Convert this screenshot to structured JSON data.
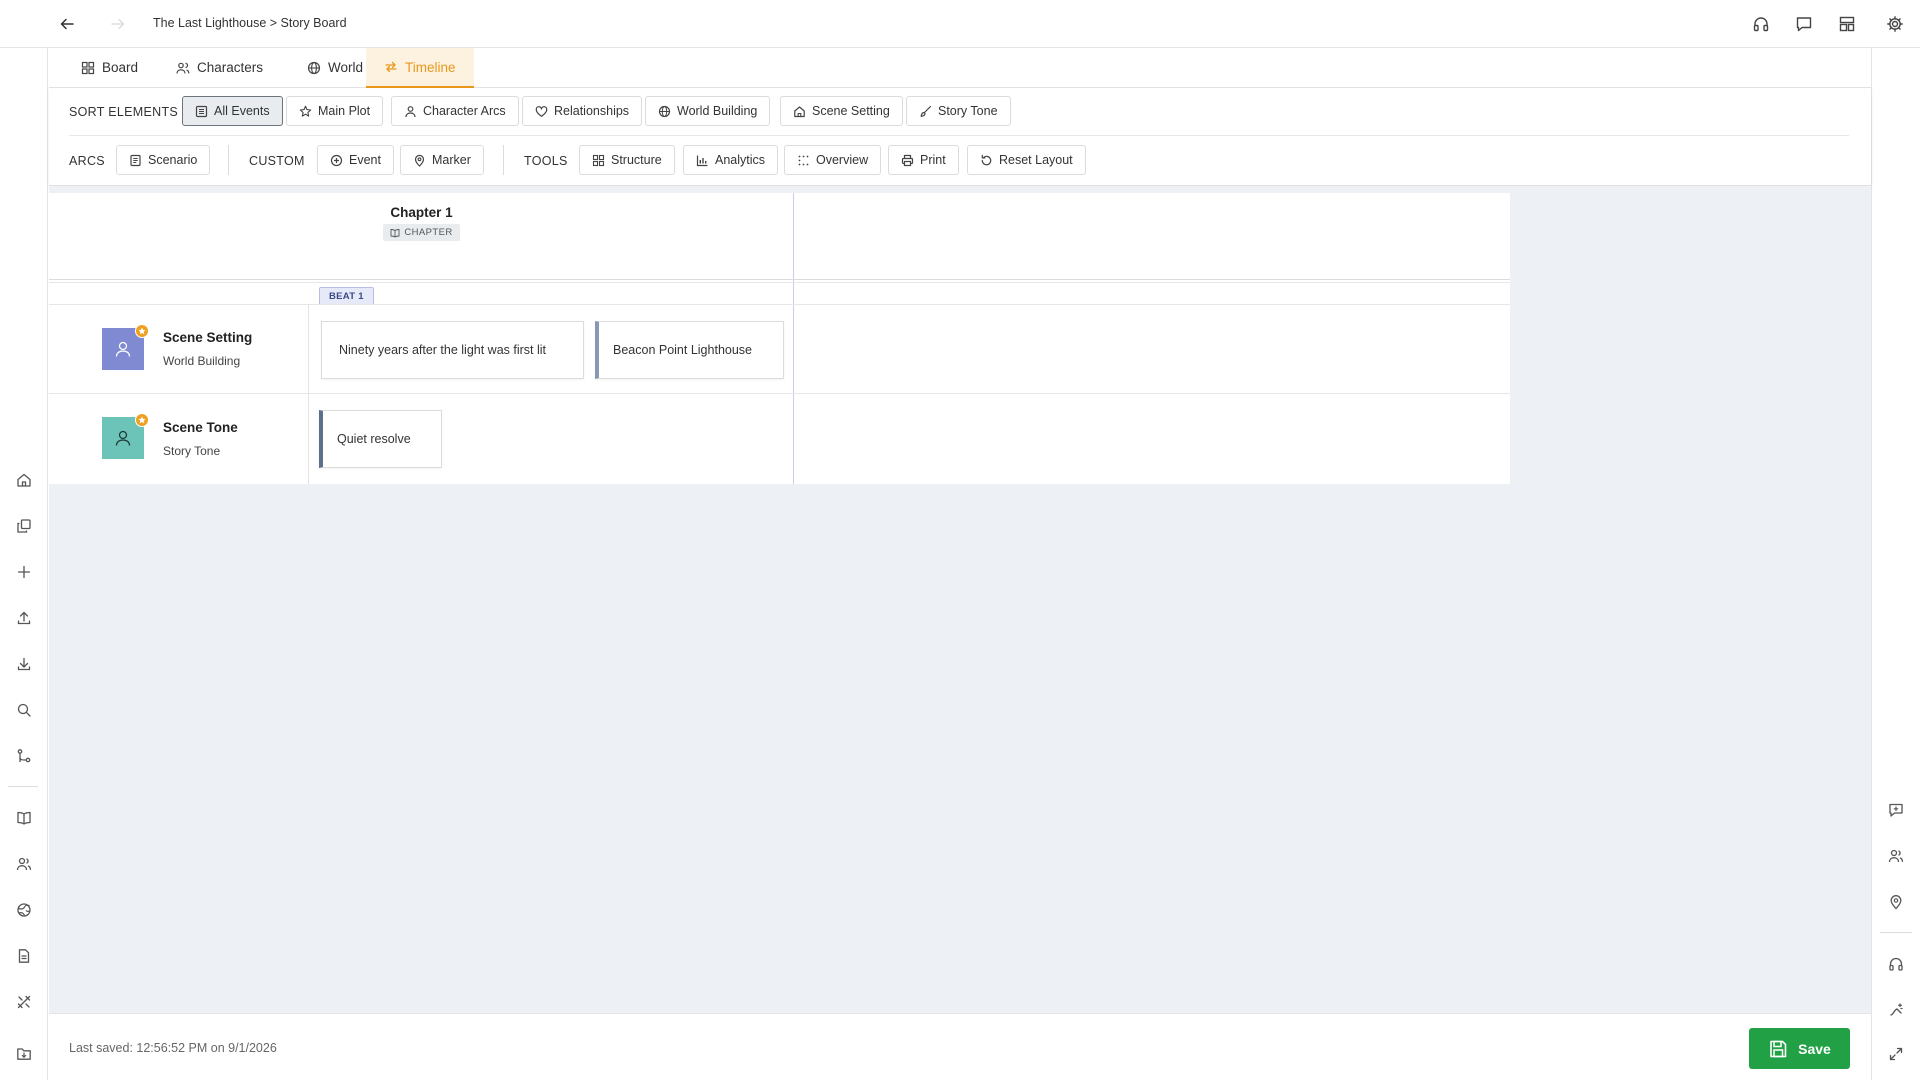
{
  "topbar": {
    "breadcrumb": "The Last Lighthouse > Story Board",
    "icons": [
      "back-icon",
      "forward-icon",
      "headphones-icon",
      "chat-icon",
      "layout-icon",
      "settings-icon"
    ]
  },
  "tabs": [
    {
      "label": "Board",
      "icon": "grid-icon"
    },
    {
      "label": "Characters",
      "icon": "users-icon"
    },
    {
      "label": "World",
      "icon": "globe-icon"
    },
    {
      "label": "Timeline",
      "icon": "arrows-icon",
      "active": true
    }
  ],
  "toolbar": {
    "sort_label": "SORT ELEMENTS",
    "sort_buttons": [
      {
        "label": "All Events",
        "selected": true
      },
      {
        "label": "Main Plot"
      },
      {
        "label": "Character Arcs"
      },
      {
        "label": "Relationships"
      },
      {
        "label": "World Building"
      },
      {
        "label": "Scene Setting"
      },
      {
        "label": "Story Tone"
      }
    ],
    "arcs_label": "ARCS",
    "arcs_buttons": [
      {
        "label": "Scenario"
      }
    ],
    "custom_label": "CUSTOM",
    "custom_buttons": [
      {
        "label": "Event"
      },
      {
        "label": "Marker"
      }
    ],
    "tools_label": "TOOLS",
    "tools_buttons": [
      {
        "label": "Structure"
      },
      {
        "label": "Analytics"
      },
      {
        "label": "Overview"
      },
      {
        "label": "Print"
      },
      {
        "label": "Reset Layout"
      }
    ]
  },
  "timeline": {
    "chapter": {
      "title": "Chapter 1",
      "badge": "CHAPTER"
    },
    "beat": "BEAT 1",
    "rows": [
      {
        "title": "Scene Setting",
        "subtitle": "World Building",
        "avatar_color": "#7f8ad3",
        "cards": [
          "Ninety years after the light was first lit",
          "Beacon Point Lighthouse"
        ]
      },
      {
        "title": "Scene Tone",
        "subtitle": "Story Tone",
        "avatar_color": "#6cc4b8",
        "cards": [
          "Quiet resolve"
        ]
      }
    ]
  },
  "footer": {
    "last_saved": "Last saved: 12:56:52 PM on 9/1/2026",
    "save_label": "Save"
  },
  "colors": {
    "accent": "#e8991c",
    "save": "#22a046",
    "canvas_bg": "#edf1f5"
  }
}
